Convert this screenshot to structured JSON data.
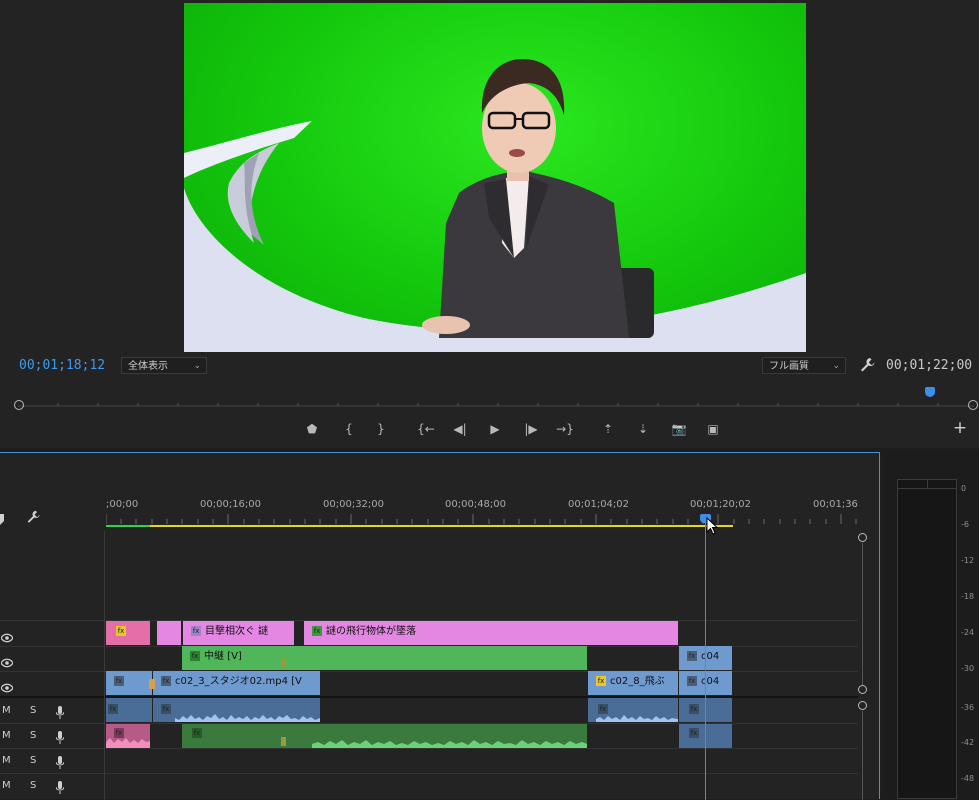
{
  "monitor": {
    "timecode_current": "00;01;18;12",
    "timecode_duration": "00;01;22;00",
    "zoom_select": "全体表示",
    "quality_select": "フル画質"
  },
  "transport": {
    "add_marker": "⬟",
    "mark_in": "{",
    "mark_out": "}",
    "go_to_in": "{←",
    "step_back": "◀|",
    "play": "▶",
    "step_forward": "|▶",
    "go_to_out": "→}",
    "lift": "⇡",
    "extract": "⇣",
    "export_frame": "📷",
    "compare": "▣",
    "add_button": "+"
  },
  "timeline": {
    "ruler_labels": [
      ";00;00",
      "00;00;16;00",
      "00;00;32;00",
      "00;00;48;00",
      "00;01;04;02",
      "00;01;20;02",
      "00;01;36"
    ],
    "clips": {
      "v3_fx": "fx",
      "v3_title1": "目撃相次ぐ 謎",
      "v3_title2": "謎の飛行物体が墜落",
      "v2_center": "中継 [V]",
      "v2_c04": "c04",
      "v1_main": "c02_3_スタジオ02.mp4 [V",
      "v1_c02_8": "c02_8_飛ぶ",
      "v1_c04": "c04"
    },
    "audio_track_labels": {
      "mute": "M",
      "solo": "S"
    }
  },
  "meter": {
    "labels": [
      "0",
      "-6",
      "-12",
      "-18",
      "-24",
      "-30",
      "-36",
      "-42",
      "-48"
    ]
  },
  "colors": {
    "accent_blue": "#4a9cf0",
    "title_clip": "#e387e2",
    "fx_clip_pink": "#e56ea8",
    "video_clip": "#6f9ad0",
    "green_clip": "#4fb75a",
    "audio_blue": "#4a6d98",
    "audio_green": "#3a7a3c"
  }
}
